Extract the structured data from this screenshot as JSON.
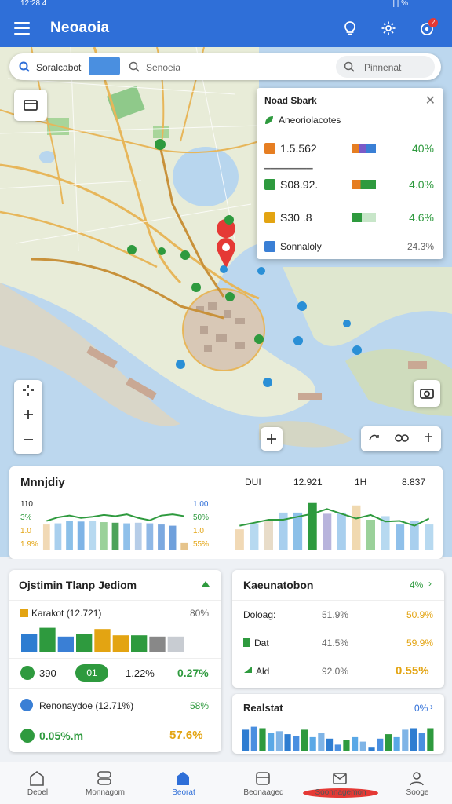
{
  "status": {
    "time": "12:28 4",
    "battery": "||| %"
  },
  "header": {
    "title": "Neoaoia"
  },
  "search": {
    "left_text": "Soralcabot",
    "middle_text": "Senoeia",
    "right_text": "Pinnenat"
  },
  "info_panel": {
    "title": "Noad Sbark",
    "subtitle": "Aneoriolacotes",
    "rows": [
      {
        "value": "1.5.562",
        "pct": "40%",
        "color": "#e67e22"
      },
      {
        "value": "S08.92.",
        "pct": "4.0%",
        "color": "#2e9a3e"
      },
      {
        "value": "S30 .8",
        "pct": "4.6%",
        "color": "#e3a412"
      },
      {
        "value": "Sonnaloly",
        "pct": "24.3%",
        "color": "#3a7fd5"
      }
    ]
  },
  "monthly_card": {
    "title": "Mnnjdiy",
    "left_labels": [
      "110",
      "3%",
      "1.0",
      "1.9%"
    ],
    "right_labels": [
      "1.00",
      "50%",
      "1.0",
      "55%"
    ],
    "top_right": {
      "label1": "DUI",
      "label2": "12.921",
      "label3": "1H",
      "label4": "8.837"
    },
    "chart_data": [
      {
        "type": "bar",
        "title": "",
        "series": [
          {
            "name": "",
            "values": [
              42,
              44,
              48,
              47,
              48,
              46,
              45,
              44,
              45,
              44,
              42,
              40,
              12
            ]
          }
        ],
        "line": [
          48,
          54,
          57,
          53,
          55,
          58,
          56,
          59,
          53,
          49,
          57,
          59,
          56
        ]
      },
      {
        "type": "bar",
        "title": "",
        "series": [
          {
            "name": "",
            "values": [
              34,
              44,
              50,
              62,
              62,
              78,
              60,
              62,
              74,
              50,
              56,
              42,
              48,
              42
            ]
          }
        ],
        "line": [
          40,
          45,
          50,
          50,
          55,
          60,
          68,
          60,
          52,
          58,
          47,
          48,
          40,
          52
        ]
      }
    ]
  },
  "card1": {
    "title": "Ojstimin Tlanp Jediom",
    "row1_label": "Karakot (12.721)",
    "row1_pct": "80%",
    "bars": [
      {
        "value": 70,
        "color": "#2e7dd1"
      },
      {
        "value": 95,
        "color": "#2e9a3e"
      },
      {
        "value": 60,
        "color": "#3a7fd5"
      },
      {
        "value": 70,
        "color": "#2e9a3e"
      },
      {
        "value": 90,
        "color": "#e3a412"
      },
      {
        "value": 65,
        "color": "#e3a412"
      },
      {
        "value": 65,
        "color": "#2e9a3e"
      },
      {
        "value": 60,
        "color": "#888888"
      },
      {
        "value": 60,
        "color": "#c8ccd2"
      }
    ],
    "row2": {
      "left": "390",
      "chip": "01",
      "mid": "1.22%",
      "right": "0.27%"
    },
    "row3": {
      "label": "Renonaydoe (12.71%)",
      "pct": "58%"
    },
    "row4": {
      "left": "0.05%.m",
      "right": "57.6%"
    }
  },
  "card2": {
    "title": "Kaeunatobon",
    "badge": "4%",
    "rows": [
      {
        "label": "Doloag:",
        "mid": "51.9%",
        "right": "50.9%"
      },
      {
        "label": "Dat",
        "mid": "41.5%",
        "right": "59.9%"
      },
      {
        "label": "Ald",
        "mid": "92.0%",
        "right": "0.55%"
      }
    ]
  },
  "card3": {
    "title": "Realstat",
    "badge": "0%",
    "chart_data": {
      "type": "bar",
      "title": "",
      "values": [
        70,
        80,
        75,
        60,
        65,
        55,
        50,
        70,
        45,
        60,
        40,
        20,
        35,
        45,
        30,
        10,
        40,
        55,
        45,
        70,
        75,
        60,
        75
      ]
    }
  },
  "nav": {
    "items": [
      {
        "label": "Deoel"
      },
      {
        "label": "Monnagom"
      },
      {
        "label": "Beorat"
      },
      {
        "label": "Beonaaged"
      },
      {
        "label": "Soonnagemon"
      },
      {
        "label": "Sooge"
      }
    ]
  },
  "colors": {
    "primary": "#2f6fd8",
    "green": "#2e9a3e",
    "orange": "#e3a412",
    "red": "#e53935"
  }
}
